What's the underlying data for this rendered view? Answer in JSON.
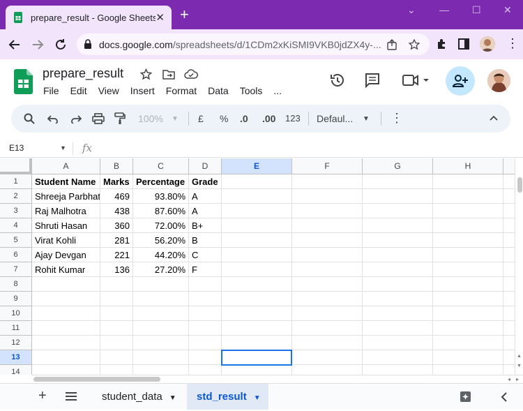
{
  "browser": {
    "tab_title": "prepare_result - Google Sheets",
    "url_host": "docs.google.com",
    "url_path": "/spreadsheets/d/1CDm2xKiSMI9VKB0jdZX4y-..."
  },
  "doc": {
    "title": "prepare_result",
    "menu": [
      "File",
      "Edit",
      "View",
      "Insert",
      "Format",
      "Data",
      "Tools",
      "..."
    ]
  },
  "toolbar": {
    "zoom": "100%",
    "currency": "£",
    "percent": "%",
    "dec_decrease": ".0",
    "dec_increase": ".00",
    "number_format": "123",
    "font": "Defaul...",
    "more": "⋮"
  },
  "formula_bar": {
    "name_box": "E13",
    "fx": "fx",
    "value": ""
  },
  "grid": {
    "columns": [
      "A",
      "B",
      "C",
      "D",
      "E",
      "F",
      "G",
      "H"
    ],
    "selected_column": "E",
    "rows": [
      "1",
      "2",
      "3",
      "4",
      "5",
      "6",
      "7",
      "8",
      "9",
      "10",
      "11",
      "12",
      "13",
      "14"
    ],
    "selected_row": "13",
    "header": [
      "Student Name",
      "Marks",
      "Percentage",
      "Grade"
    ],
    "data": [
      [
        "Shreeja Parbhat",
        "469",
        "93.80%",
        "A"
      ],
      [
        "Raj Malhotra",
        "438",
        "87.60%",
        "A"
      ],
      [
        "Shruti Hasan",
        "360",
        "72.00%",
        "B+"
      ],
      [
        "Virat Kohli",
        "281",
        "56.20%",
        "B"
      ],
      [
        "Ajay Devgan",
        "221",
        "44.20%",
        "C"
      ],
      [
        "Rohit Kumar",
        "136",
        "27.20%",
        "F"
      ]
    ],
    "selected_cell": "E13"
  },
  "sheets": {
    "tabs": [
      "student_data",
      "std_result"
    ],
    "active": "std_result"
  },
  "colors": {
    "browser_frame": "#7c2bb0",
    "toolbar_bg": "#f1e4fb",
    "selection": "#1a73e8",
    "sheets_green": "#0f9d58",
    "share_bg": "#c2e7ff"
  }
}
